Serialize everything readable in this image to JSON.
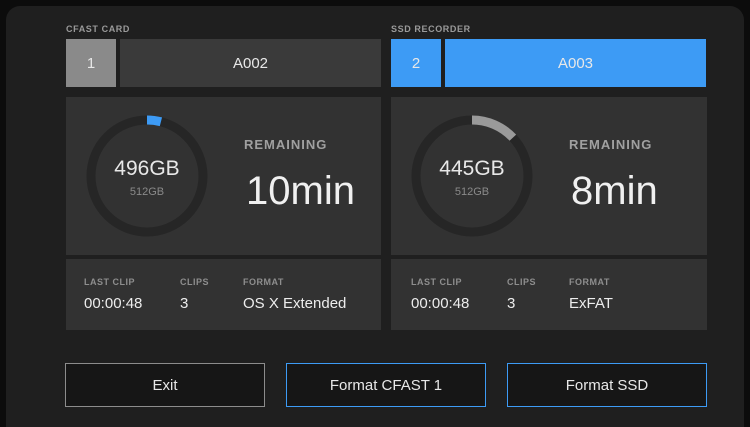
{
  "cfast": {
    "section_label": "CFAST CARD",
    "slot_number": "1",
    "clip_name": "A002",
    "capacity_free": "496GB",
    "capacity_total": "512GB",
    "used_fraction": 0.04,
    "remaining_label": "REMAINING",
    "remaining_value": "10min",
    "last_clip_label": "LAST CLIP",
    "last_clip_value": "00:00:48",
    "clips_label": "CLIPS",
    "clips_value": "3",
    "format_label": "FORMAT",
    "format_value": "OS X Extended"
  },
  "ssd": {
    "section_label": "SSD RECORDER",
    "slot_number": "2",
    "clip_name": "A003",
    "capacity_free": "445GB",
    "capacity_total": "512GB",
    "used_fraction": 0.13,
    "remaining_label": "REMAINING",
    "remaining_value": "8min",
    "last_clip_label": "LAST CLIP",
    "last_clip_value": "00:00:48",
    "clips_label": "CLIPS",
    "clips_value": "3",
    "format_label": "FORMAT",
    "format_value": "ExFAT"
  },
  "buttons": {
    "exit": "Exit",
    "format_cfast": "Format CFAST 1",
    "format_ssd": "Format SSD"
  },
  "colors": {
    "accent_blue": "#3d9bf5",
    "used_cfast": "#3d9bf5",
    "used_ssd": "#9a9a9a",
    "ring_track": "#262626",
    "inactive_slot": "#8a8a8a",
    "slot_name_bg": "#3a3a3a",
    "button_border_active": "#3d9bf5",
    "button_border_default": "#8c8c8c"
  }
}
